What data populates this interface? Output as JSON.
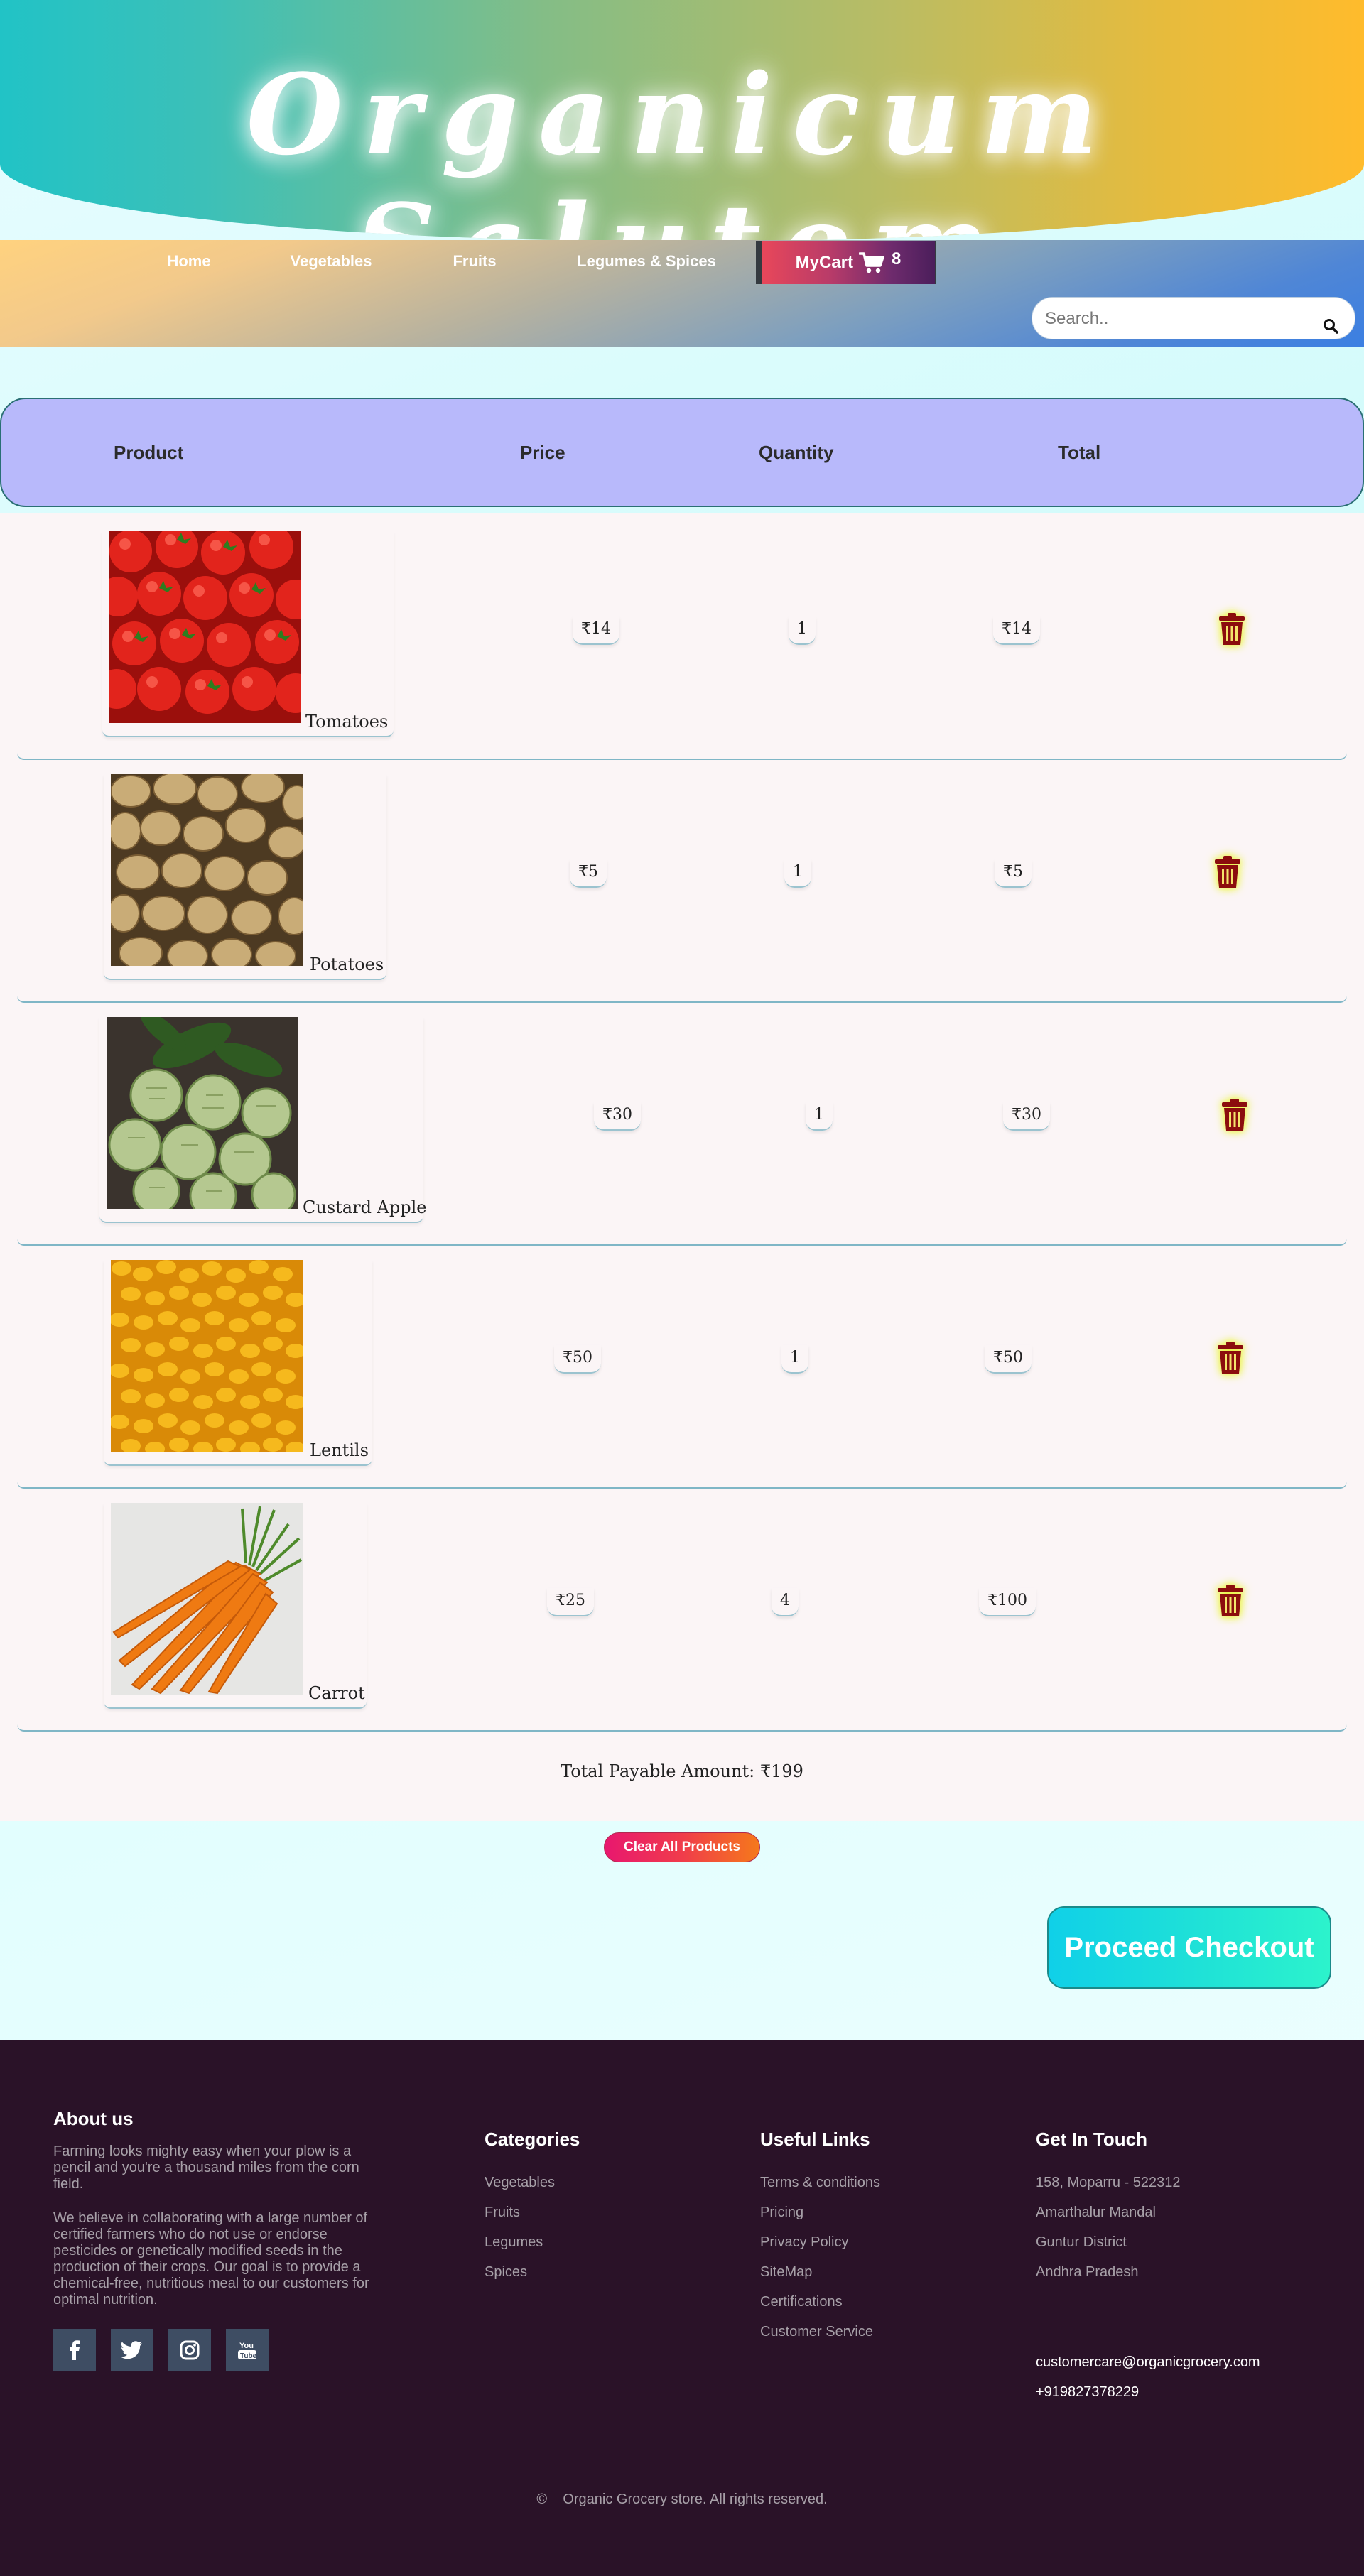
{
  "header": {
    "brand": "Organicum Salutem"
  },
  "nav": {
    "items": [
      {
        "label": "Home"
      },
      {
        "label": "Vegetables"
      },
      {
        "label": "Fruits"
      },
      {
        "label": "Legumes & Spices"
      }
    ],
    "cart_label": "MyCart",
    "cart_count": "8",
    "search_placeholder": "Search.."
  },
  "table": {
    "headers": {
      "product": "Product",
      "price": "Price",
      "quantity": "Quantity",
      "total": "Total"
    },
    "rows": [
      {
        "name": "Tomatoes",
        "price": "₹14",
        "qty": "1",
        "total": "₹14"
      },
      {
        "name": "Potatoes",
        "price": "₹5",
        "qty": "1",
        "total": "₹5"
      },
      {
        "name": "Custard Apple",
        "price": "₹30",
        "qty": "1",
        "total": "₹30"
      },
      {
        "name": "Lentils",
        "price": "₹50",
        "qty": "1",
        "total": "₹50"
      },
      {
        "name": "Carrot",
        "price": "₹25",
        "qty": "4",
        "total": "₹100"
      }
    ],
    "grand_total": "Total Payable Amount: ₹199"
  },
  "actions": {
    "clear": "Clear All Products",
    "checkout": "Proceed Checkout"
  },
  "footer": {
    "about_title": "About us",
    "about_p1": "Farming looks mighty easy when your plow is a pencil and you're a thousand miles from the corn field.",
    "about_p2": "We believe in collaborating with a large number of certified farmers who do not use or endorse pesticides or genetically modified seeds in the production of their crops. Our goal is to provide a chemical-free, nutritious meal to our customers for optimal nutrition.",
    "categories_title": "Categories",
    "categories": [
      "Vegetables",
      "Fruits",
      "Legumes",
      "Spices"
    ],
    "links_title": "Useful Links",
    "links": [
      "Terms & conditions",
      "Pricing",
      "Privacy Policy",
      "SiteMap",
      "Certifications",
      "Customer Service"
    ],
    "contact_title": "Get In Touch",
    "address": [
      "158, Moparru - 522312",
      "Amarthalur Mandal",
      "Guntur District",
      "Andhra Pradesh"
    ],
    "email": "customercare@organicgrocery.com",
    "phone": "+919827378229",
    "copyright_symbol": "©",
    "copyright": "Organic Grocery store. All rights reserved."
  },
  "colors": {
    "header_band": "#b8b9fb",
    "footer_bg": "#2a1228",
    "trash": "#8b0d0d"
  }
}
